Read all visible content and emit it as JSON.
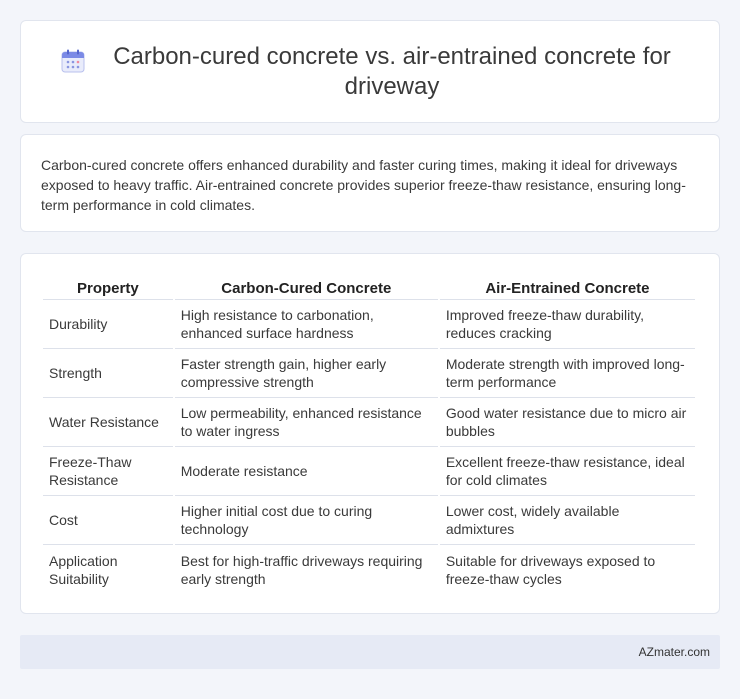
{
  "header": {
    "title": "Carbon-cured concrete vs. air-entrained concrete for driveway",
    "icon": "calendar-icon"
  },
  "summary": {
    "text": "Carbon-cured concrete offers enhanced durability and faster curing times, making it ideal for driveways exposed to heavy traffic. Air-entrained concrete provides superior freeze-thaw resistance, ensuring long-term performance in cold climates."
  },
  "table": {
    "headers": [
      "Property",
      "Carbon-Cured Concrete",
      "Air-Entrained Concrete"
    ],
    "rows": [
      [
        "Durability",
        "High resistance to carbonation, enhanced surface hardness",
        "Improved freeze-thaw durability, reduces cracking"
      ],
      [
        "Strength",
        "Faster strength gain, higher early compressive strength",
        "Moderate strength with improved long-term performance"
      ],
      [
        "Water Resistance",
        "Low permeability, enhanced resistance to water ingress",
        "Good water resistance due to micro air bubbles"
      ],
      [
        "Freeze-Thaw Resistance",
        "Moderate resistance",
        "Excellent freeze-thaw resistance, ideal for cold climates"
      ],
      [
        "Cost",
        "Higher initial cost due to curing technology",
        "Lower cost, widely available admixtures"
      ],
      [
        "Application Suitability",
        "Best for high-traffic driveways requiring early strength",
        "Suitable for driveways exposed to freeze-thaw cycles"
      ]
    ]
  },
  "footer": {
    "brand": "AZmater.com"
  },
  "colors": {
    "background": "#f3f5fa",
    "card": "#ffffff",
    "footer": "#e6eaf5",
    "icon_accent": "#6f7fe0"
  }
}
